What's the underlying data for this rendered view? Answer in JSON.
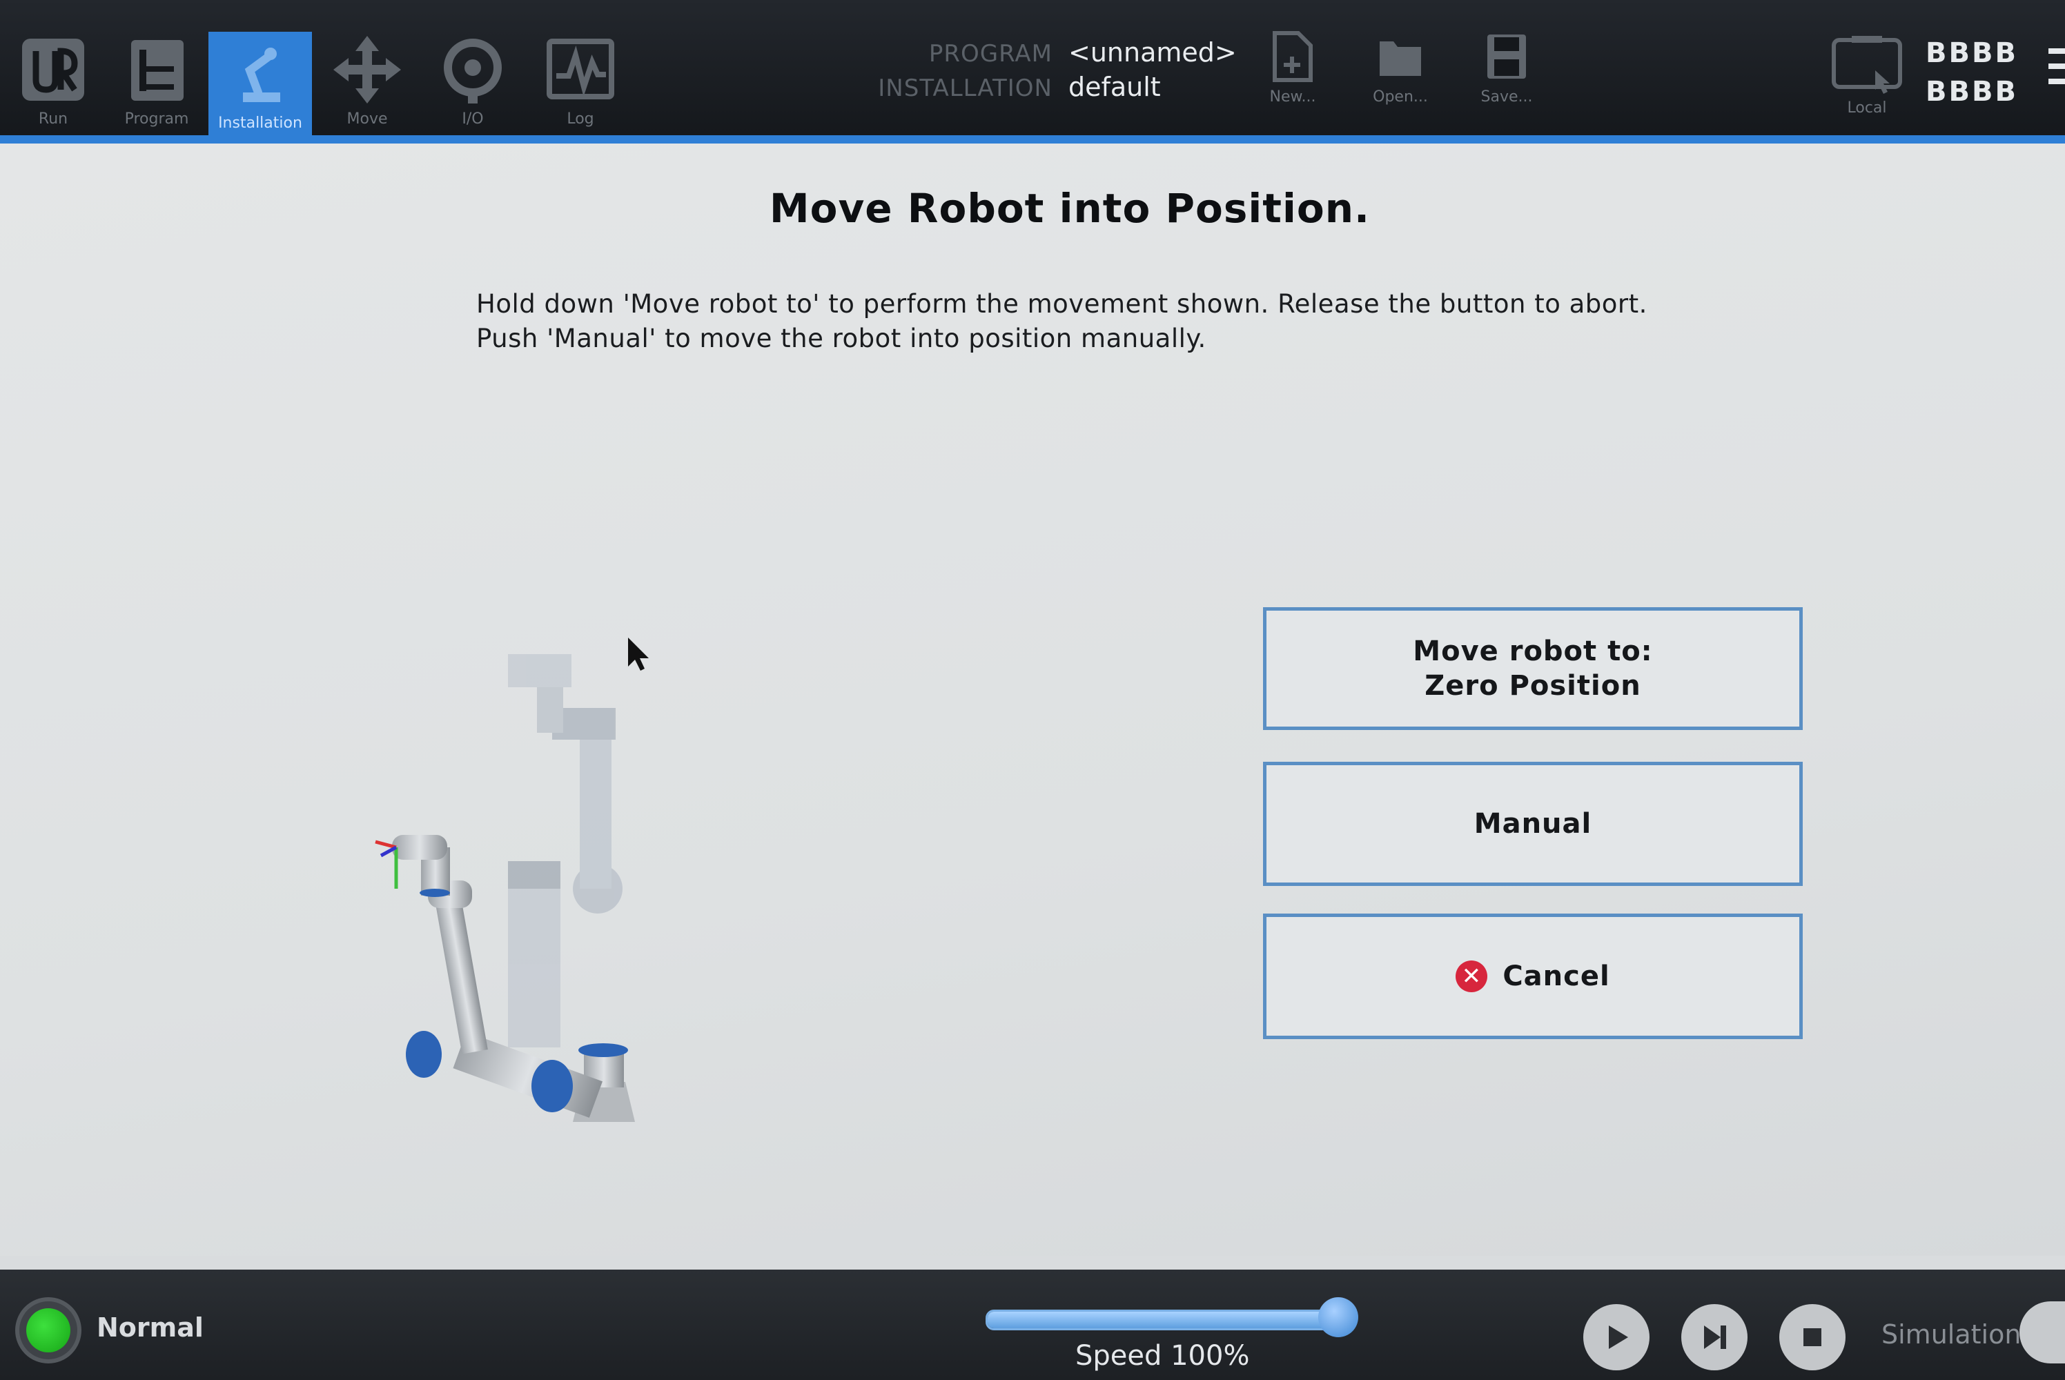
{
  "nav": {
    "tabs": [
      {
        "label": "Run",
        "icon": "ur-logo-icon"
      },
      {
        "label": "Program",
        "icon": "program-icon"
      },
      {
        "label": "Installation",
        "icon": "installation-icon",
        "active": true
      },
      {
        "label": "Move",
        "icon": "move-arrows-icon"
      },
      {
        "label": "I/O",
        "icon": "io-icon"
      },
      {
        "label": "Log",
        "icon": "log-chart-icon"
      }
    ]
  },
  "program": {
    "program_label": "PROGRAM",
    "program_value": "<unnamed>",
    "installation_label": "INSTALLATION",
    "installation_value": "default"
  },
  "file_actions": {
    "new_label": "New...",
    "open_label": "Open...",
    "save_label": "Save..."
  },
  "header_right": {
    "local_label": "Local",
    "line1": "BBBB",
    "line2": "BBBB"
  },
  "main": {
    "title": "Move Robot into Position.",
    "instruction_line1": "Hold down 'Move robot to' to perform the movement shown. Release the button to abort.",
    "instruction_line2": "Push 'Manual' to move the robot into position manually.",
    "move_button_line1": "Move robot to:",
    "move_button_line2": "Zero Position",
    "manual_button": "Manual",
    "cancel_button": "Cancel"
  },
  "footer": {
    "status": "Normal",
    "speed_label": "Speed 100%",
    "speed_fraction": 1.0,
    "simulation_label": "Simulation"
  },
  "colors": {
    "accent": "#2f7fd6",
    "status_ok": "#22c022",
    "cancel": "#d7263d"
  }
}
